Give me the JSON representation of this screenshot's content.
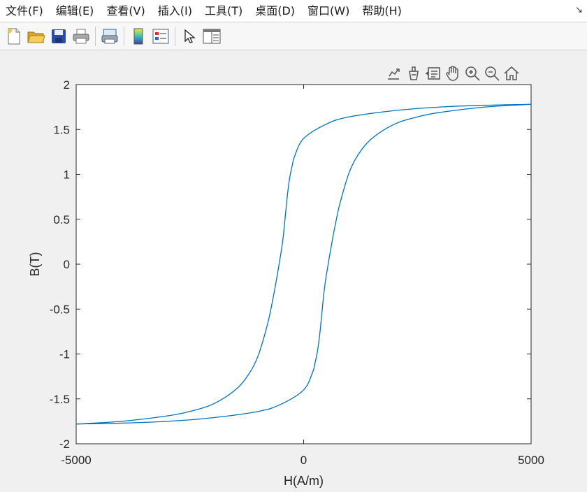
{
  "menu": {
    "items": [
      "文件(F)",
      "编辑(E)",
      "查看(V)",
      "插入(I)",
      "工具(T)",
      "桌面(D)",
      "窗口(W)",
      "帮助(H)"
    ]
  },
  "toolbar": {
    "icons": [
      "new-file-icon",
      "open-folder-icon",
      "save-icon",
      "print-icon",
      "print-preview-icon",
      "colorbar-icon",
      "legend-icon",
      "select-pointer-icon",
      "property-inspector-icon"
    ]
  },
  "axes_toolbar": {
    "icons": [
      "export-icon",
      "brush-icon",
      "datatip-icon",
      "pan-hand-icon",
      "zoom-in-icon",
      "zoom-out-icon",
      "home-icon"
    ]
  },
  "colors": {
    "line": "#0072bd",
    "axis": "#262626"
  },
  "chart_data": {
    "type": "line",
    "title": "",
    "xlabel": "H(A/m)",
    "ylabel": "B(T)",
    "xlim": [
      -5000,
      5000
    ],
    "ylim": [
      -2,
      2
    ],
    "xticks": [
      -5000,
      0,
      5000
    ],
    "yticks": [
      -2,
      -1.5,
      -1,
      -0.5,
      0,
      0.5,
      1,
      1.5,
      2
    ],
    "xtick_labels": [
      "-5000",
      "0",
      "5000"
    ],
    "ytick_labels": [
      "-2",
      "-1.5",
      "-1",
      "-0.5",
      "0",
      "0.5",
      "1",
      "1.5",
      "2"
    ],
    "grid": false,
    "series": [
      {
        "x": [
          -5000,
          -4000,
          -3000,
          -2500,
          -2000,
          -1500,
          -1200,
          -1000,
          -800,
          -700,
          -600,
          -500,
          -450,
          -400,
          -350,
          -300,
          -250,
          -200,
          0,
          500,
          1000,
          2000,
          3000,
          4000,
          5000
        ],
        "y": [
          -1.78,
          -1.75,
          -1.69,
          -1.64,
          -1.56,
          -1.4,
          -1.22,
          -1.02,
          -0.68,
          -0.45,
          -0.18,
          0.12,
          0.3,
          0.55,
          0.8,
          0.98,
          1.1,
          1.2,
          1.4,
          1.56,
          1.64,
          1.71,
          1.75,
          1.77,
          1.78
        ]
      },
      {
        "x": [
          -5000,
          -4000,
          -3000,
          -2000,
          -1000,
          -500,
          0,
          200,
          250,
          300,
          350,
          400,
          450,
          500,
          600,
          700,
          800,
          1000,
          1200,
          1500,
          2000,
          2500,
          3000,
          4000,
          5000
        ],
        "y": [
          -1.78,
          -1.77,
          -1.75,
          -1.71,
          -1.64,
          -1.56,
          -1.4,
          -1.2,
          -1.1,
          -0.98,
          -0.8,
          -0.55,
          -0.3,
          -0.12,
          0.18,
          0.45,
          0.68,
          1.02,
          1.22,
          1.4,
          1.56,
          1.64,
          1.69,
          1.75,
          1.78
        ]
      }
    ]
  }
}
